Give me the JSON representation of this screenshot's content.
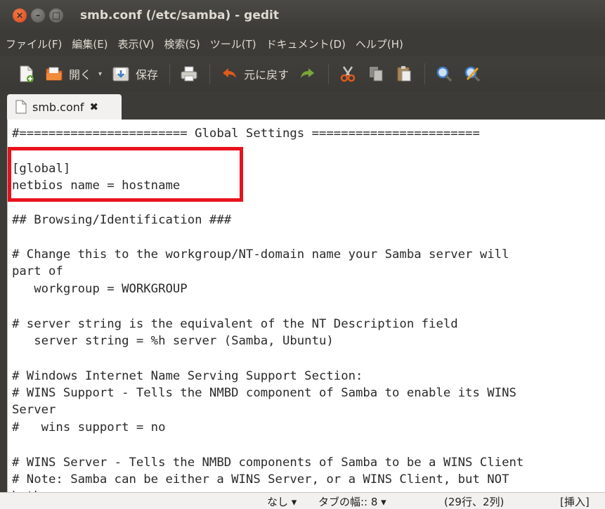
{
  "window": {
    "title": "smb.conf (/etc/samba) - gedit",
    "controls": [
      "×",
      "–",
      "□"
    ]
  },
  "menu": [
    "ファイル(F)",
    "編集(E)",
    "表示(V)",
    "検索(S)",
    "ツール(T)",
    "ドキュメント(D)",
    "ヘルプ(H)"
  ],
  "toolbar": {
    "new": {
      "icon": "new-document-icon"
    },
    "open": {
      "icon": "open-folder-icon",
      "label": "開く",
      "arrow": "▾"
    },
    "save": {
      "icon": "save-icon",
      "label": "保存"
    },
    "print": {
      "icon": "print-icon"
    },
    "undo": {
      "icon": "undo-arrow-icon",
      "label": "元に戻す"
    },
    "redo": {
      "icon": "redo-arrow-icon"
    },
    "cut": {
      "icon": "scissors-icon"
    },
    "copy": {
      "icon": "copy-icon"
    },
    "paste": {
      "icon": "paste-icon"
    },
    "find": {
      "icon": "magnifier-icon"
    },
    "replace": {
      "icon": "find-replace-icon"
    }
  },
  "tab": {
    "label": "smb.conf",
    "close": "✖"
  },
  "editor": {
    "lines": [
      "#======================= Global Settings =======================",
      "",
      "[global]",
      "netbios name = hostname",
      "",
      "## Browsing/Identification ###",
      "",
      "# Change this to the workgroup/NT-domain name your Samba server will",
      "part of",
      "   workgroup = WORKGROUP",
      "",
      "# server string is the equivalent of the NT Description field",
      "   server string = %h server (Samba, Ubuntu)",
      "",
      "# Windows Internet Name Serving Support Section:",
      "# WINS Support - Tells the NMBD component of Samba to enable its WINS",
      "Server",
      "#   wins support = no",
      "",
      "# WINS Server - Tells the NMBD components of Samba to be a WINS Client",
      "# Note: Samba can be either a WINS Server, or a WINS Client, but NOT",
      "both"
    ]
  },
  "statusbar": {
    "highlight": "なし ▾",
    "tab_width": "タブの幅:: 8 ▾",
    "position": "(29行、2列)",
    "mode": "[挿入]"
  },
  "colors": {
    "accent_orange": "#e05a1c",
    "highlight_red": "#e8121d"
  }
}
